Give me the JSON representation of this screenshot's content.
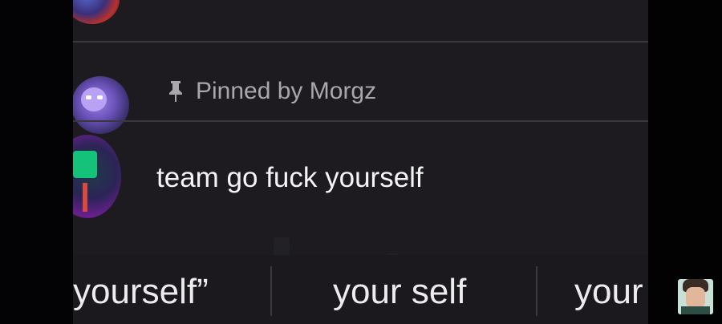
{
  "comments": {
    "pinned": {
      "label": "Pinned by Morgz"
    },
    "comment": {
      "text": "team go fuck yourself"
    }
  },
  "keyboard": {
    "suggestions": [
      {
        "text": "yourself”"
      },
      {
        "text": "your self"
      },
      {
        "text": "your"
      }
    ]
  },
  "icons": {
    "pin": "pin-icon"
  },
  "colors": {
    "background": "#1d1b1f",
    "pinned_text": "#a9a7ab",
    "comment_text": "#f4f3f5"
  }
}
